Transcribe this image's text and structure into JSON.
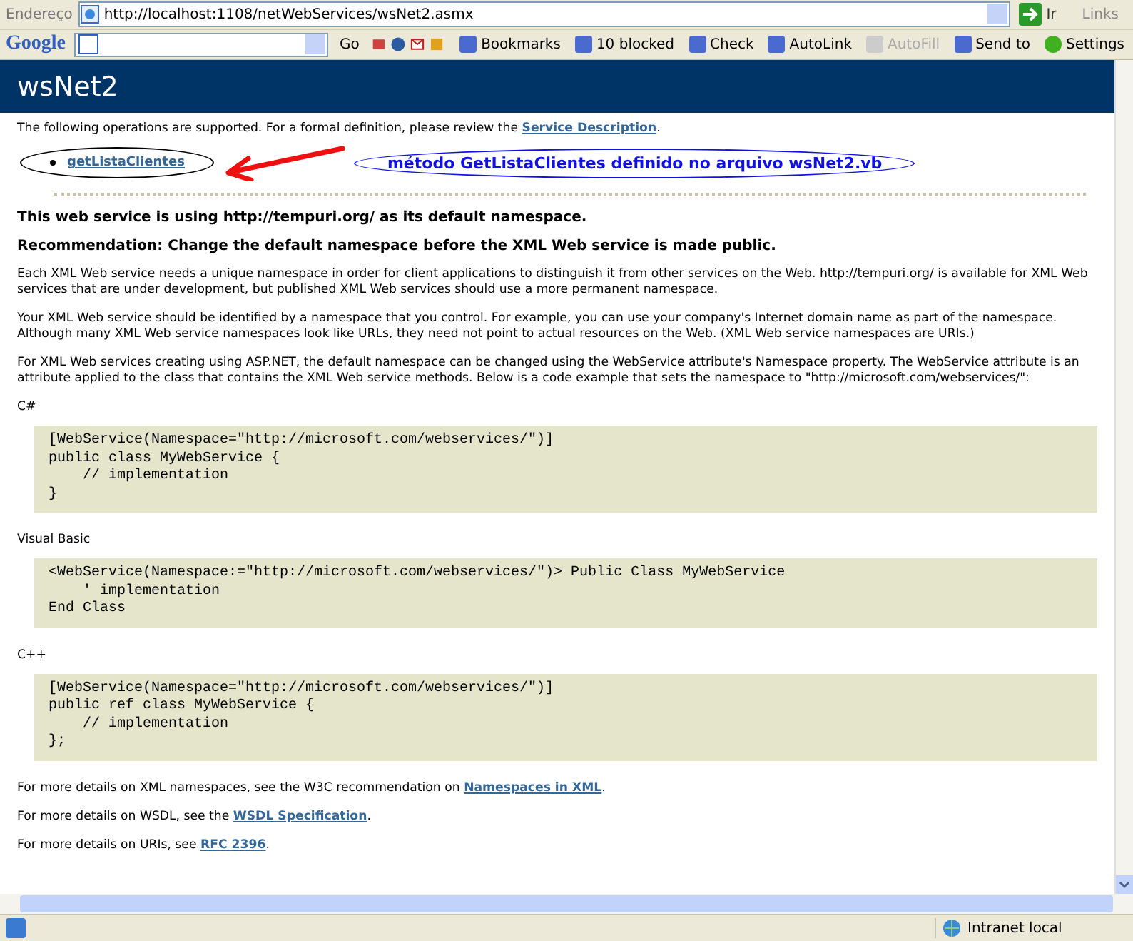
{
  "address_bar": {
    "label": "Endereço",
    "url": "http://localhost:1108/netWebServices/wsNet2.asmx",
    "go": "Ir",
    "links": "Links"
  },
  "google_toolbar": {
    "logo": "Google",
    "go": "Go",
    "items": [
      {
        "label": "Bookmarks",
        "disabled": false
      },
      {
        "label": "10 blocked",
        "disabled": false
      },
      {
        "label": "Check",
        "disabled": false
      },
      {
        "label": "AutoLink",
        "disabled": false
      },
      {
        "label": "AutoFill",
        "disabled": true
      },
      {
        "label": "Send to",
        "disabled": false
      }
    ],
    "settings": "Settings"
  },
  "page": {
    "title": "wsNet2",
    "intro": {
      "before": "The following operations are supported. For a formal definition, please review the ",
      "link": "Service Description",
      "after": "."
    },
    "operations": [
      "getListaClientes"
    ],
    "annotation": "método GetListaClientes definido no arquivo wsNet2.vb",
    "headings": [
      "This web service is using http://tempuri.org/ as its default namespace.",
      "Recommendation: Change the default namespace before the XML Web service is made public."
    ],
    "paragraphs": [
      "Each XML Web service needs a unique namespace in order for client applications to distinguish it from other services on the Web. http://tempuri.org/ is available for XML Web services that are under development, but published XML Web services should use a more permanent namespace.",
      "Your XML Web service should be identified by a namespace that you control. For example, you can use your company's Internet domain name as part of the namespace. Although many XML Web service namespaces look like URLs, they need not point to actual resources on the Web. (XML Web service namespaces are URIs.)",
      "For XML Web services creating using ASP.NET, the default namespace can be changed using the WebService attribute's Namespace property. The WebService attribute is an attribute applied to the class that contains the XML Web service methods. Below is a code example that sets the namespace to \"http://microsoft.com/webservices/\":"
    ],
    "code_samples": [
      {
        "label": "C#",
        "lines": [
          "[WebService(Namespace=\"http://microsoft.com/webservices/\")]",
          "public class MyWebService {",
          "    // implementation",
          "}"
        ]
      },
      {
        "label": "Visual Basic",
        "lines": [
          "<WebService(Namespace:=\"http://microsoft.com/webservices/\")> Public Class MyWebService",
          "    ' implementation",
          "End Class"
        ]
      },
      {
        "label": "C++",
        "lines": [
          "[WebService(Namespace=\"http://microsoft.com/webservices/\")]",
          "public ref class MyWebService {",
          "    // implementation",
          "};"
        ]
      }
    ],
    "more_details": [
      {
        "before": "For more details on XML namespaces, see the W3C recommendation on ",
        "link": "Namespaces in XML",
        "after": "."
      },
      {
        "before": "For more details on WSDL, see the ",
        "link": "WSDL Specification",
        "after": "."
      },
      {
        "before": "For more details on URIs, see ",
        "link": "RFC 2396",
        "after": "."
      }
    ]
  },
  "status_bar": {
    "zone": "Intranet local"
  }
}
